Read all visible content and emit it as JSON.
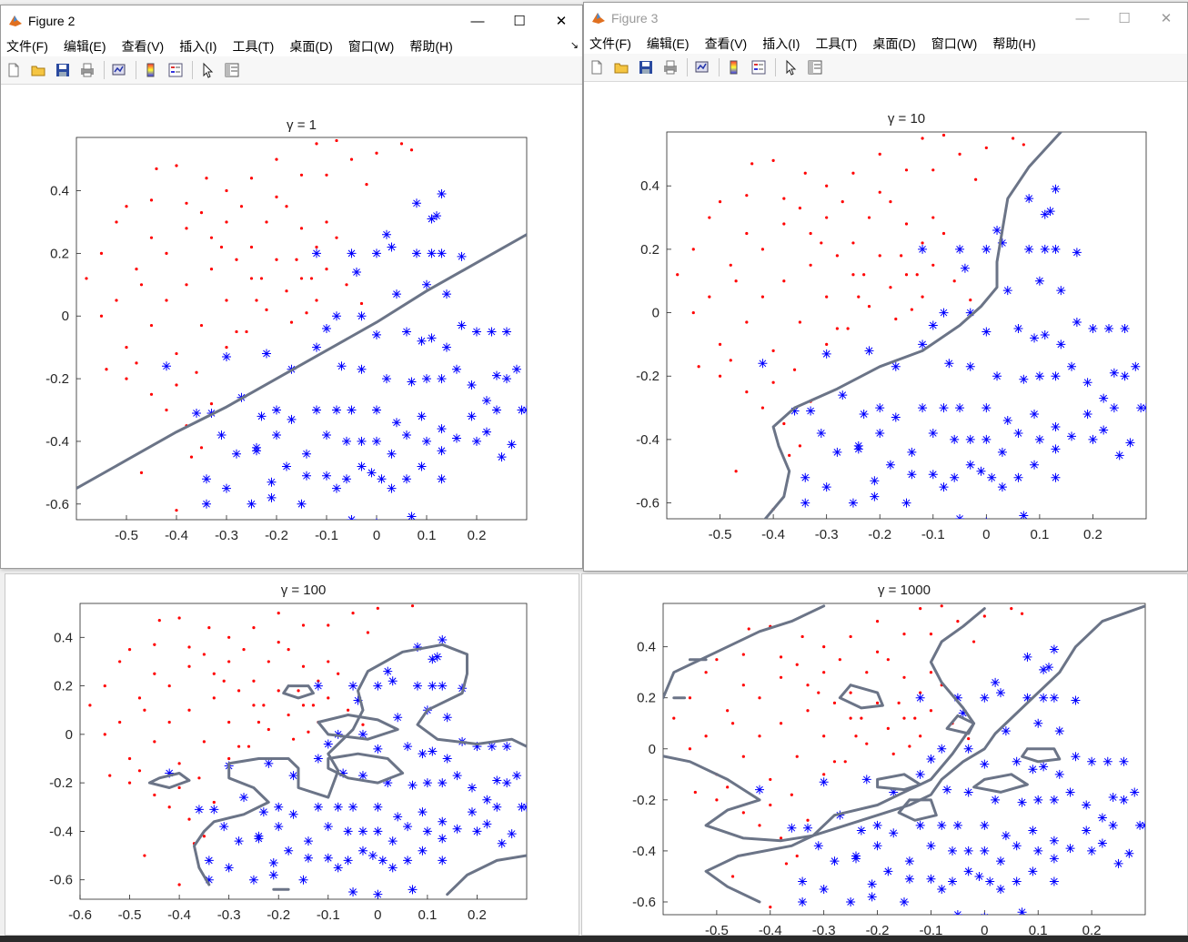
{
  "windows": {
    "fig2": {
      "title": "Figure 2"
    },
    "fig3": {
      "title": "Figure 3"
    }
  },
  "menu": [
    "文件(F)",
    "编辑(E)",
    "查看(V)",
    "插入(I)",
    "工具(T)",
    "桌面(D)",
    "窗口(W)",
    "帮助(H)"
  ],
  "toolbar_icons": [
    "new-figure-icon",
    "open-file-icon",
    "save-icon",
    "print-icon",
    "link-plot-icon",
    "insert-colorbar-icon",
    "insert-legend-icon",
    "pointer-icon",
    "property-inspector-icon"
  ],
  "colors": {
    "class1": "#ff0000",
    "class2": "#0000ff",
    "boundary": "#6b7487"
  },
  "chart_data": [
    {
      "type": "scatter",
      "title": "γ = 1",
      "xticks": [
        "-0.5",
        "-0.4",
        "-0.3",
        "-0.2",
        "-0.1",
        "0",
        "0.1",
        "0.2"
      ],
      "yticks": [
        "0.4",
        "0.2",
        "0",
        "-0.2",
        "-0.4",
        "-0.6"
      ],
      "xlim": [
        -0.6,
        0.3
      ],
      "ylim": [
        -0.65,
        0.57
      ]
    },
    {
      "type": "scatter",
      "title": "γ = 10",
      "xticks": [
        "-0.5",
        "-0.4",
        "-0.3",
        "-0.2",
        "-0.1",
        "0",
        "0.1",
        "0.2"
      ],
      "yticks": [
        "0.4",
        "0.2",
        "0",
        "-0.2",
        "-0.4",
        "-0.6"
      ],
      "xlim": [
        -0.6,
        0.3
      ],
      "ylim": [
        -0.65,
        0.57
      ]
    },
    {
      "type": "scatter",
      "title": "γ = 100",
      "xticks": [
        "-0.6",
        "-0.5",
        "-0.4",
        "-0.3",
        "-0.2",
        "-0.1",
        "0",
        "0.1",
        "0.2"
      ],
      "yticks": [
        "0.4",
        "0.2",
        "0",
        "-0.2",
        "-0.4",
        "-0.6"
      ],
      "xlim": [
        -0.6,
        0.3
      ],
      "ylim": [
        -0.68,
        0.54
      ]
    },
    {
      "type": "scatter",
      "title": "γ = 1000",
      "xticks": [
        "-0.5",
        "-0.4",
        "-0.3",
        "-0.2",
        "-0.1",
        "0",
        "0.1",
        "0.2"
      ],
      "yticks": [
        "0.4",
        "0.2",
        "0",
        "-0.2",
        "-0.4",
        "-0.6"
      ],
      "xlim": [
        -0.6,
        0.3
      ],
      "ylim": [
        -0.65,
        0.57
      ]
    }
  ],
  "dataset": {
    "class1_red_dots": [
      [
        -0.5,
        0.35
      ],
      [
        -0.45,
        0.37
      ],
      [
        -0.4,
        0.48
      ],
      [
        -0.38,
        0.36
      ],
      [
        -0.35,
        0.33
      ],
      [
        -0.3,
        0.4
      ],
      [
        -0.25,
        0.44
      ],
      [
        -0.2,
        0.5
      ],
      [
        -0.15,
        0.45
      ],
      [
        -0.12,
        0.55
      ],
      [
        -0.08,
        0.56
      ],
      [
        -0.05,
        0.5
      ],
      [
        0.0,
        0.52
      ],
      [
        0.05,
        0.55
      ],
      [
        -0.55,
        0.2
      ],
      [
        -0.52,
        0.3
      ],
      [
        -0.48,
        0.15
      ],
      [
        -0.45,
        0.25
      ],
      [
        -0.42,
        0.2
      ],
      [
        -0.38,
        0.28
      ],
      [
        -0.33,
        0.25
      ],
      [
        -0.3,
        0.3
      ],
      [
        -0.28,
        0.18
      ],
      [
        -0.25,
        0.22
      ],
      [
        -0.22,
        0.3
      ],
      [
        -0.18,
        0.35
      ],
      [
        -0.15,
        0.28
      ],
      [
        -0.12,
        0.22
      ],
      [
        -0.1,
        0.3
      ],
      [
        -0.08,
        0.25
      ],
      [
        -0.55,
        0.0
      ],
      [
        -0.52,
        0.05
      ],
      [
        -0.5,
        -0.1
      ],
      [
        -0.47,
        0.1
      ],
      [
        -0.45,
        -0.03
      ],
      [
        -0.42,
        0.05
      ],
      [
        -0.4,
        -0.12
      ],
      [
        -0.38,
        0.1
      ],
      [
        -0.35,
        -0.03
      ],
      [
        -0.33,
        0.15
      ],
      [
        -0.3,
        0.05
      ],
      [
        -0.28,
        -0.05
      ],
      [
        -0.25,
        0.12
      ],
      [
        -0.22,
        0.02
      ],
      [
        -0.2,
        0.18
      ],
      [
        -0.18,
        0.08
      ],
      [
        -0.15,
        0.12
      ],
      [
        -0.12,
        0.05
      ],
      [
        -0.1,
        0.15
      ],
      [
        -0.05,
        0.2
      ],
      [
        -0.5,
        -0.2
      ],
      [
        -0.48,
        -0.15
      ],
      [
        -0.45,
        -0.25
      ],
      [
        -0.42,
        -0.3
      ],
      [
        -0.4,
        -0.22
      ],
      [
        -0.38,
        -0.35
      ],
      [
        -0.36,
        -0.18
      ],
      [
        -0.35,
        -0.42
      ],
      [
        -0.33,
        -0.28
      ],
      [
        -0.3,
        -0.1
      ],
      [
        -0.47,
        -0.5
      ],
      [
        -0.4,
        -0.62
      ],
      [
        -0.37,
        -0.45
      ],
      [
        -0.27,
        0.35
      ],
      [
        -0.2,
        0.38
      ],
      [
        -0.16,
        0.18
      ],
      [
        -0.14,
        0.01
      ],
      [
        -0.24,
        0.05
      ],
      [
        -0.26,
        -0.05
      ],
      [
        -0.06,
        0.1
      ],
      [
        -0.03,
        0.04
      ],
      [
        -0.58,
        0.12
      ],
      [
        -0.54,
        -0.17
      ],
      [
        -0.44,
        0.47
      ],
      [
        -0.34,
        0.44
      ],
      [
        -0.1,
        0.45
      ],
      [
        0.07,
        0.53
      ],
      [
        -0.02,
        0.42
      ],
      [
        -0.31,
        0.22
      ],
      [
        -0.23,
        0.12
      ],
      [
        -0.17,
        -0.02
      ],
      [
        -0.13,
        0.12
      ]
    ],
    "class2_blue_stars": [
      [
        0.08,
        0.36
      ],
      [
        0.13,
        0.39
      ],
      [
        0.11,
        0.31
      ],
      [
        0.12,
        0.32
      ],
      [
        0.02,
        0.26
      ],
      [
        0.08,
        0.2
      ],
      [
        0.13,
        0.2
      ],
      [
        0.17,
        0.19
      ],
      [
        0.11,
        0.2
      ],
      [
        0.1,
        0.1
      ],
      [
        0.14,
        0.07
      ],
      [
        -0.04,
        0.14
      ],
      [
        -0.12,
        0.2
      ],
      [
        -0.05,
        0.2
      ],
      [
        0.0,
        0.2
      ],
      [
        0.03,
        0.22
      ],
      [
        -0.08,
        0.0
      ],
      [
        -0.1,
        -0.04
      ],
      [
        -0.03,
        0.0
      ],
      [
        0.0,
        -0.06
      ],
      [
        0.04,
        0.07
      ],
      [
        0.06,
        -0.05
      ],
      [
        0.09,
        -0.08
      ],
      [
        0.11,
        -0.07
      ],
      [
        0.14,
        -0.1
      ],
      [
        0.17,
        -0.03
      ],
      [
        0.2,
        -0.05
      ],
      [
        0.23,
        -0.05
      ],
      [
        0.26,
        -0.05
      ],
      [
        0.28,
        -0.17
      ],
      [
        0.26,
        -0.2
      ],
      [
        0.24,
        -0.19
      ],
      [
        -0.42,
        -0.16
      ],
      [
        -0.3,
        -0.13
      ],
      [
        -0.22,
        -0.12
      ],
      [
        -0.17,
        -0.17
      ],
      [
        -0.12,
        -0.1
      ],
      [
        -0.07,
        -0.16
      ],
      [
        -0.03,
        -0.17
      ],
      [
        0.02,
        -0.2
      ],
      [
        0.07,
        -0.21
      ],
      [
        0.1,
        -0.2
      ],
      [
        0.13,
        -0.2
      ],
      [
        0.16,
        -0.17
      ],
      [
        0.19,
        -0.22
      ],
      [
        0.22,
        -0.27
      ],
      [
        0.24,
        -0.3
      ],
      [
        -0.36,
        -0.31
      ],
      [
        -0.33,
        -0.31
      ],
      [
        -0.27,
        -0.26
      ],
      [
        -0.23,
        -0.32
      ],
      [
        -0.2,
        -0.3
      ],
      [
        -0.17,
        -0.33
      ],
      [
        -0.12,
        -0.3
      ],
      [
        -0.08,
        -0.3
      ],
      [
        -0.05,
        -0.3
      ],
      [
        0.0,
        -0.3
      ],
      [
        0.04,
        -0.34
      ],
      [
        0.09,
        -0.32
      ],
      [
        0.13,
        -0.36
      ],
      [
        0.19,
        -0.32
      ],
      [
        0.22,
        -0.37
      ],
      [
        -0.31,
        -0.38
      ],
      [
        -0.24,
        -0.43
      ],
      [
        -0.2,
        -0.38
      ],
      [
        -0.14,
        -0.44
      ],
      [
        -0.1,
        -0.38
      ],
      [
        -0.06,
        -0.4
      ],
      [
        -0.03,
        -0.4
      ],
      [
        0.0,
        -0.4
      ],
      [
        0.03,
        -0.44
      ],
      [
        0.06,
        -0.38
      ],
      [
        0.1,
        -0.4
      ],
      [
        0.13,
        -0.43
      ],
      [
        0.16,
        -0.39
      ],
      [
        0.2,
        -0.4
      ],
      [
        0.25,
        -0.45
      ],
      [
        0.27,
        -0.41
      ],
      [
        -0.34,
        -0.52
      ],
      [
        -0.3,
        -0.55
      ],
      [
        -0.21,
        -0.53
      ],
      [
        -0.18,
        -0.48
      ],
      [
        -0.14,
        -0.51
      ],
      [
        -0.1,
        -0.51
      ],
      [
        -0.08,
        -0.55
      ],
      [
        -0.06,
        -0.52
      ],
      [
        -0.03,
        -0.48
      ],
      [
        -0.01,
        -0.5
      ],
      [
        0.01,
        -0.52
      ],
      [
        0.03,
        -0.55
      ],
      [
        0.06,
        -0.52
      ],
      [
        0.09,
        -0.48
      ],
      [
        0.13,
        -0.52
      ],
      [
        -0.34,
        -0.6
      ],
      [
        -0.25,
        -0.6
      ],
      [
        -0.21,
        -0.58
      ],
      [
        -0.15,
        -0.6
      ],
      [
        -0.05,
        -0.65
      ],
      [
        0.0,
        -0.66
      ],
      [
        0.07,
        -0.64
      ],
      [
        -0.24,
        -0.42
      ],
      [
        -0.28,
        -0.44
      ],
      [
        0.3,
        -0.3
      ],
      [
        0.29,
        -0.3
      ]
    ]
  }
}
